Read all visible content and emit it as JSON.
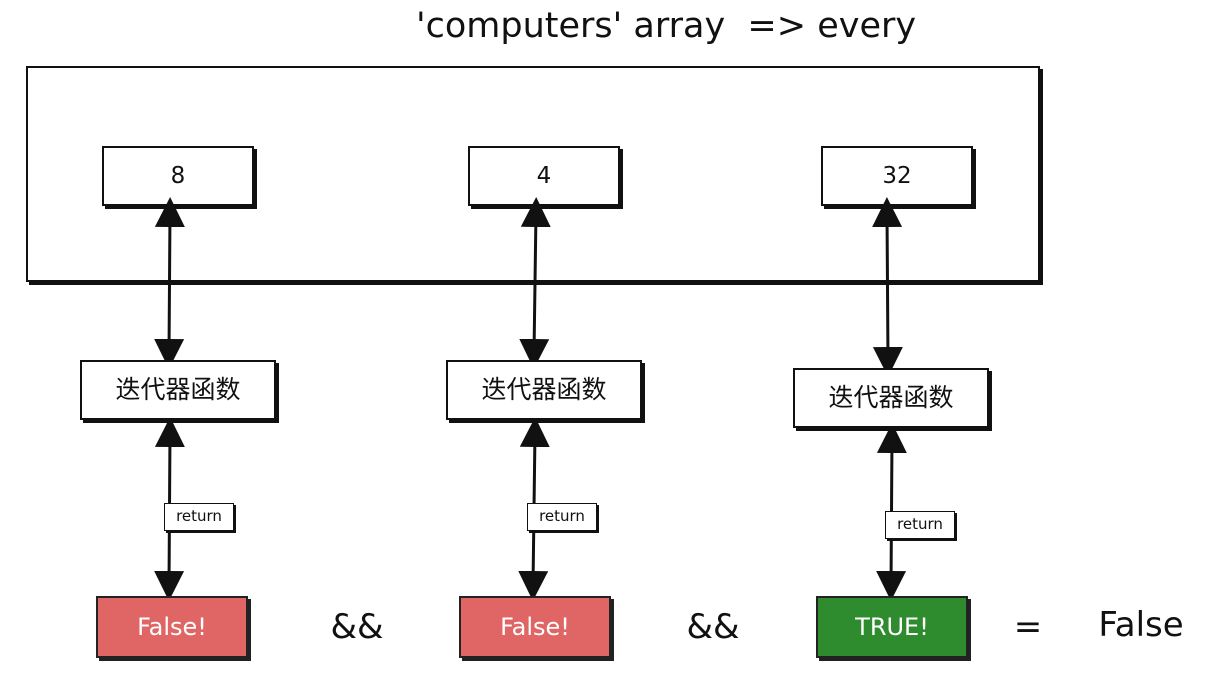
{
  "title": "'computers' array  => every",
  "values": [
    "8",
    "4",
    "32"
  ],
  "iterator_label": "迭代器函数",
  "return_label": "return",
  "results": [
    {
      "label": "False!",
      "color": "#e06666"
    },
    {
      "label": "False!",
      "color": "#e06666"
    },
    {
      "label": "TRUE!",
      "color": "#2e8b2e"
    }
  ],
  "operators": [
    "&&",
    "&&",
    "="
  ],
  "final_result": "False"
}
